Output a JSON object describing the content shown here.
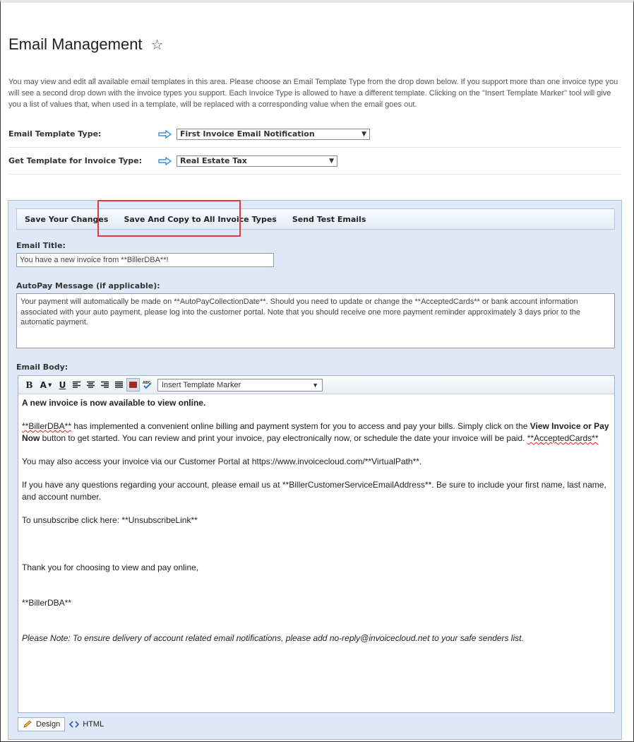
{
  "page": {
    "title": "Email Management",
    "intro": "You may view and edit all available email templates in this area. Please choose an Email Template Type from the drop down below. If you support more than one invoice type you will see a second drop down with the invoice types you support. Each Invoice Type is allowed to have a different template. Clicking on the \"Insert Template Marker\" tool will give you a list of values that, when used in a template, will be replaced with a corresponding value when the email goes out."
  },
  "form": {
    "template_type_label": "Email Template Type:",
    "template_type_value": "First Invoice Email Notification",
    "invoice_type_label": "Get Template for Invoice Type:",
    "invoice_type_value": "Real Estate Tax"
  },
  "toolbar": {
    "save_label": "Save Your Changes",
    "save_copy_label": "Save And Copy to All Invoice Types",
    "send_test_label": "Send Test Emails"
  },
  "email_title": {
    "label": "Email Title:",
    "value": "You have a new invoice from **BillerDBA**!"
  },
  "autopay": {
    "label": "AutoPay Message (if applicable):",
    "value": "Your payment will automatically be made on **AutoPayCollectionDate**. Should you need to update or change the **AcceptedCards** or bank account information associated with your auto payment, please log into the customer portal. Note that you should receive one more payment reminder approximately 3 days prior to the automatic payment."
  },
  "body": {
    "label": "Email Body:",
    "marker_select": "Insert Template Marker",
    "heading": "A new invoice is now available to view online.",
    "p1_token": "**BillerDBA**",
    "p1_text_a": " has implemented a convenient online billing and payment system for you to access and pay your bills. Simply click on the ",
    "p1_bold": "View Invoice or Pay Now",
    "p1_text_b": " button to get started. You can review and print your invoice, pay electronically now, or schedule the date your invoice will be paid.  ",
    "p1_cards": "**AcceptedCards**",
    "p2": "You may also access your invoice via our Customer Portal at https://www.invoicecloud.com/**VirtualPath**.",
    "p3": "If you have any questions regarding your account, please email us at **BillerCustomerServiceEmailAddress**. Be sure to include your first name, last name, and account number.",
    "p4": "To unsubscribe click here: **UnsubscribeLink**",
    "p5": "Thank you for choosing to view and pay online,",
    "p6": "**BillerDBA**",
    "p7": "Please Note: To ensure delivery of account related email notifications, please add no-reply@invoicecloud.net to your safe senders list."
  },
  "modes": {
    "design": "Design",
    "html": "HTML"
  },
  "colors": {
    "panel_bg": "#dfe8f6",
    "highlight_border": "#e03a3e",
    "arrow": "#3a8fd6"
  }
}
